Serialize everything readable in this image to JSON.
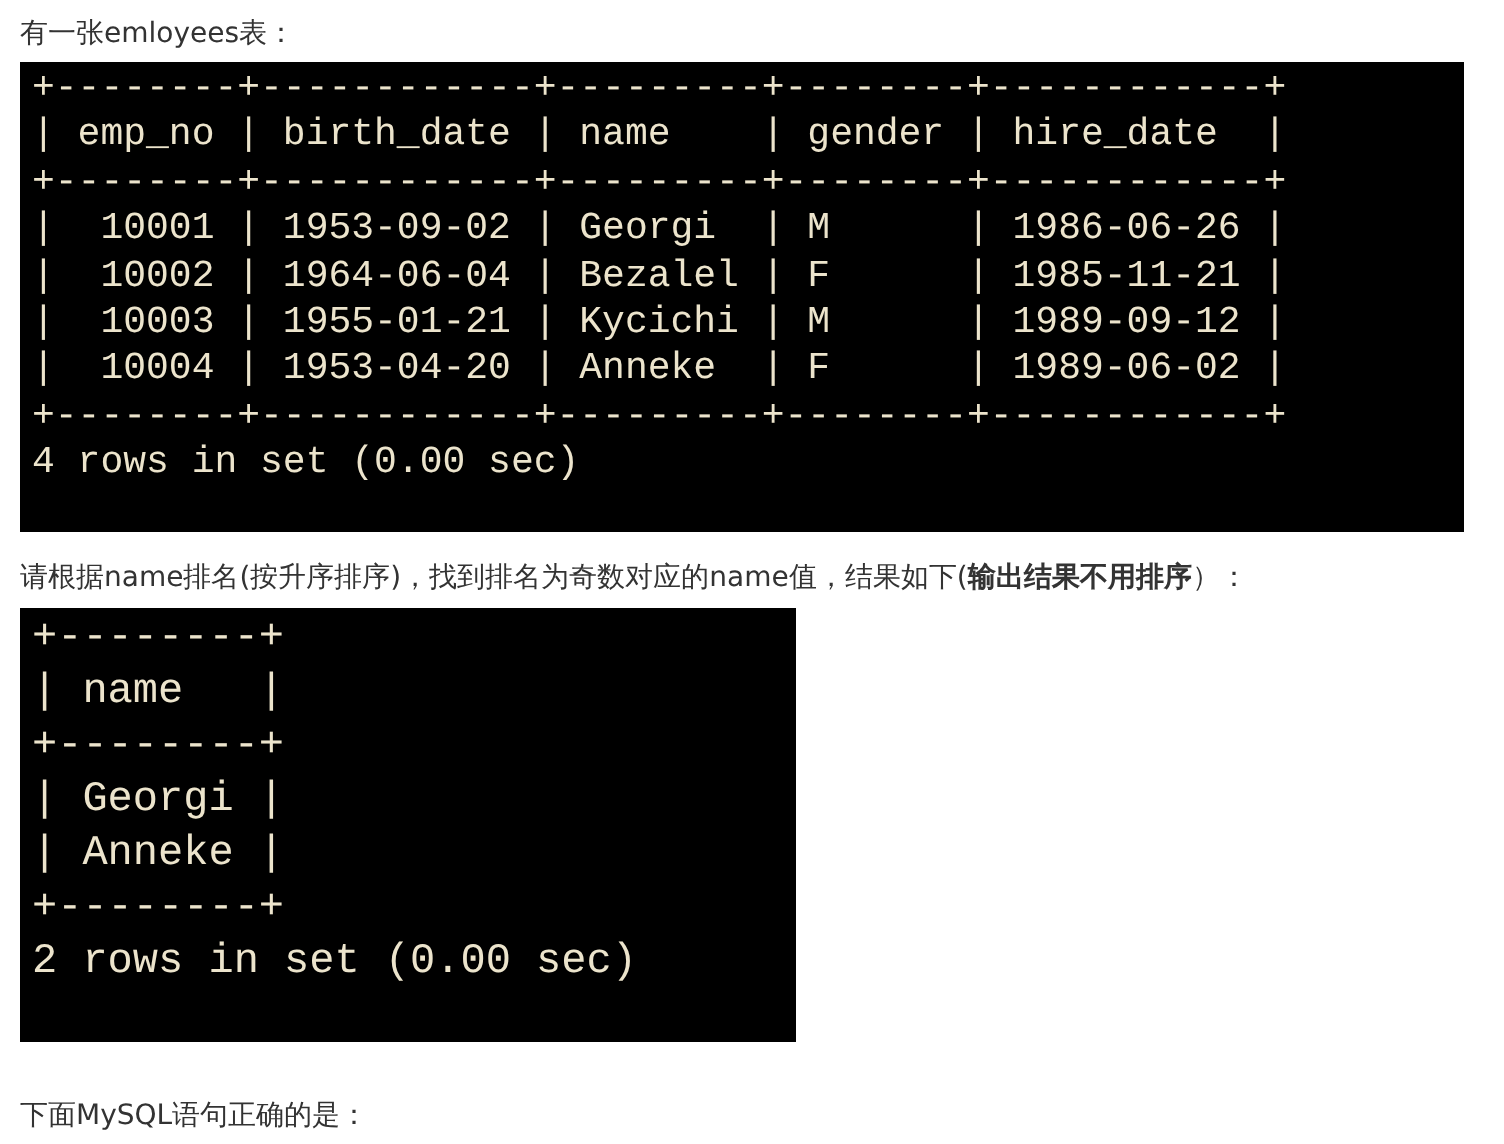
{
  "intro": "有一张emloyees表：",
  "table_output": {
    "lines": [
      "+--------+------------+---------+--------+------------+",
      "| emp_no | birth_date | name    | gender | hire_date  |",
      "+--------+------------+---------+--------+------------+",
      "|  10001 | 1953-09-02 | Georgi  | M      | 1986-06-26 |",
      "|  10002 | 1964-06-04 | Bezalel | F      | 1985-11-21 |",
      "|  10003 | 1955-01-21 | Kycichi | M      | 1989-09-12 |",
      "|  10004 | 1953-04-20 | Anneke  | F      | 1989-06-02 |",
      "+--------+------------+---------+--------+------------+",
      "4 rows in set (0.00 sec)"
    ]
  },
  "task": "请根据name排名(按升序排序)，找到排名为奇数对应的name值，结果如下(**输出结果不用排序**）：",
  "result_output": {
    "lines": [
      "+--------+",
      "| name   |",
      "+--------+",
      "| Georgi |",
      "| Anneke |",
      "+--------+",
      "2 rows in set (0.00 sec)"
    ]
  },
  "question": "下面MySQL语句正确的是："
}
